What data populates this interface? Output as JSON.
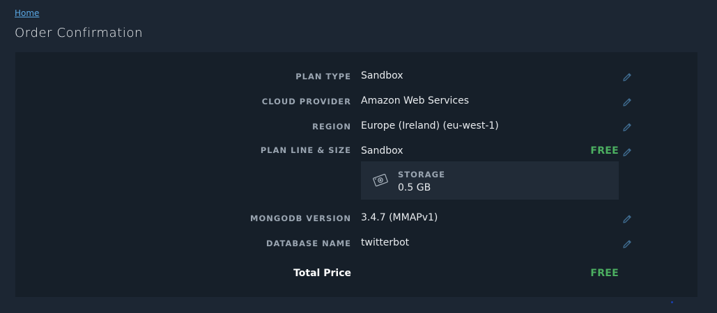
{
  "breadcrumb": {
    "home": "Home"
  },
  "page": {
    "title": "Order Confirmation"
  },
  "rows": {
    "plan_type": {
      "label": "PLAN TYPE",
      "value": "Sandbox"
    },
    "cloud_provider": {
      "label": "CLOUD PROVIDER",
      "value": "Amazon Web Services"
    },
    "region": {
      "label": "REGION",
      "value": "Europe (Ireland) (eu-west-1)"
    },
    "plan_line": {
      "label": "PLAN LINE & SIZE",
      "value": "Sandbox",
      "price": "FREE"
    },
    "storage": {
      "label": "STORAGE",
      "value": "0.5 GB"
    },
    "mongodb_version": {
      "label": "MONGODB VERSION",
      "value": "3.4.7 (MMAPv1)"
    },
    "database_name": {
      "label": "DATABASE NAME",
      "value": "twitterbot"
    }
  },
  "total": {
    "label": "Total Price",
    "value": "FREE"
  },
  "colors": {
    "accent_green": "#4caf61",
    "link": "#5aa9e6",
    "panel": "#161f29",
    "background": "#1c2633"
  },
  "icons": {
    "edit": "pencil-icon",
    "storage": "storage-disk-icon"
  }
}
